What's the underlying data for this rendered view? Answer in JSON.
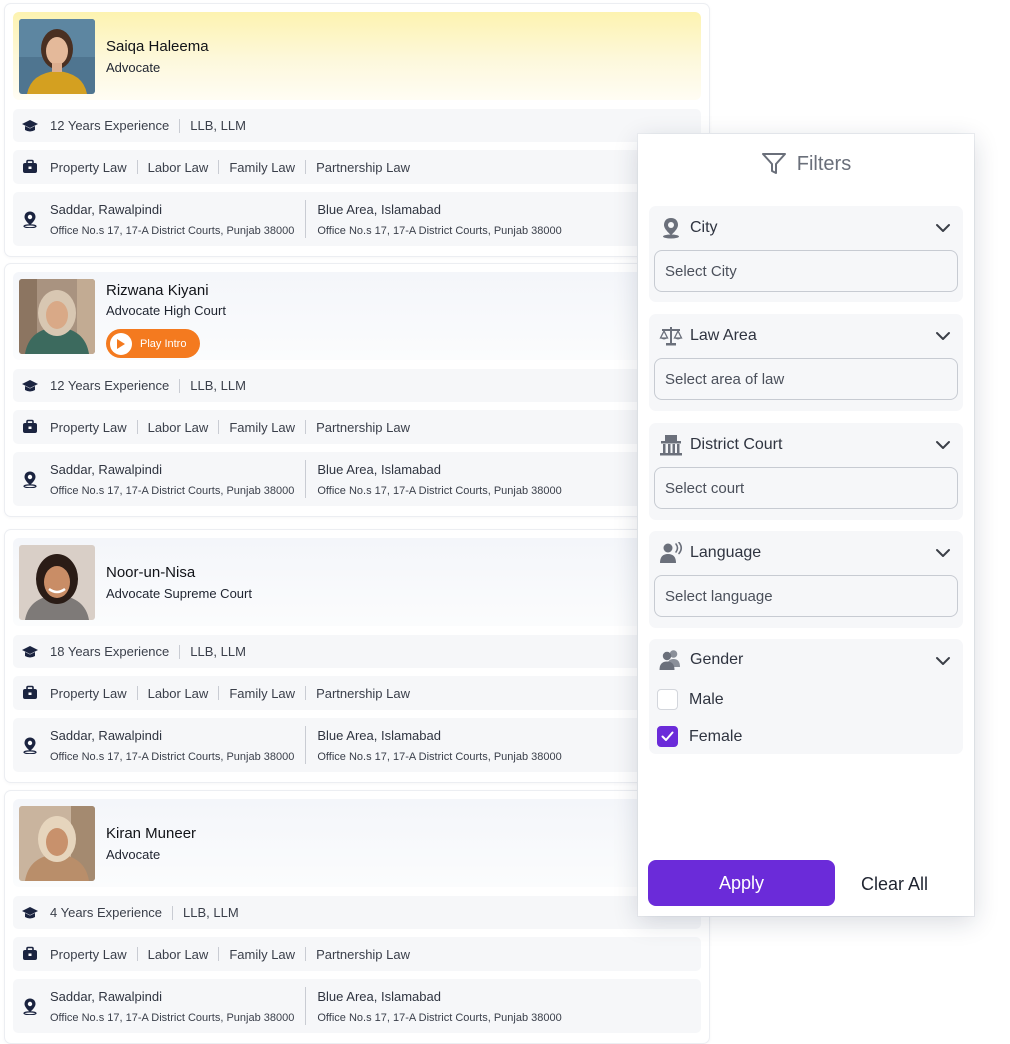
{
  "colors": {
    "accent": "#6b2bd9",
    "intro": "#f47a1f",
    "featured": "#fdf3b0"
  },
  "lawyers": [
    {
      "name": "Saiqa Haleema",
      "role": "Advocate",
      "experience": "12 Years Experience",
      "degrees": "LLB, LLM",
      "areas": [
        "Property Law",
        "Labor Law",
        "Family Law",
        "Partnership Law"
      ],
      "office1": {
        "city": "Saddar, Rawalpindi",
        "address": "Office No.s 17, 17-A District Courts, Punjab 38000"
      },
      "office2": {
        "city": "Blue Area, Islamabad",
        "address": "Office No.s 17, 17-A District Courts, Punjab 38000"
      }
    },
    {
      "name": "Rizwana Kiyani",
      "role": "Advocate High Court",
      "intro_label": "Play Intro",
      "experience": "12 Years Experience",
      "degrees": "LLB, LLM",
      "areas": [
        "Property Law",
        "Labor Law",
        "Family Law",
        "Partnership Law"
      ],
      "office1": {
        "city": "Saddar, Rawalpindi",
        "address": "Office No.s 17, 17-A District Courts, Punjab 38000"
      },
      "office2": {
        "city": "Blue Area, Islamabad",
        "address": "Office No.s 17, 17-A District Courts, Punjab 38000"
      }
    },
    {
      "name": "Noor-un-Nisa",
      "role": "Advocate Supreme Court",
      "experience": "18 Years Experience",
      "degrees": "LLB, LLM",
      "areas": [
        "Property Law",
        "Labor Law",
        "Family Law",
        "Partnership Law"
      ],
      "office1": {
        "city": "Saddar, Rawalpindi",
        "address": "Office No.s 17, 17-A District Courts, Punjab 38000"
      },
      "office2": {
        "city": "Blue Area, Islamabad",
        "address": "Office No.s 17, 17-A District Courts, Punjab 38000"
      }
    },
    {
      "name": "Kiran Muneer",
      "role": "Advocate",
      "experience": "4 Years Experience",
      "degrees": "LLB, LLM",
      "areas": [
        "Property Law",
        "Labor Law",
        "Family Law",
        "Partnership Law"
      ],
      "office1": {
        "city": "Saddar, Rawalpindi",
        "address": "Office No.s 17, 17-A District Courts, Punjab 38000"
      },
      "office2": {
        "city": "Blue Area, Islamabad",
        "address": "Office No.s 17, 17-A District Courts, Punjab 38000"
      }
    }
  ],
  "filters": {
    "title": "Filters",
    "city": {
      "label": "City",
      "placeholder": "Select City"
    },
    "law_area": {
      "label": "Law Area",
      "placeholder": "Select area of law"
    },
    "district_court": {
      "label": "District Court",
      "placeholder": "Select court"
    },
    "language": {
      "label": "Language",
      "placeholder": "Select language"
    },
    "gender": {
      "label": "Gender",
      "options": [
        {
          "label": "Male",
          "checked": false
        },
        {
          "label": "Female",
          "checked": true
        }
      ]
    },
    "apply_label": "Apply",
    "clear_label": "Clear All"
  }
}
